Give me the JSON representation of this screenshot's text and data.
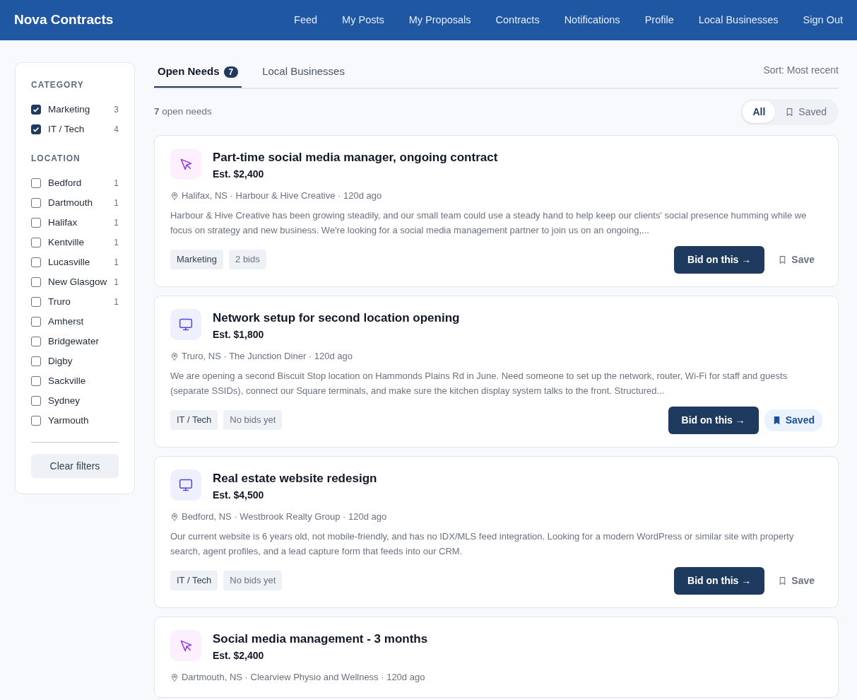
{
  "brand": "Nova Contracts",
  "nav": [
    "Feed",
    "My Posts",
    "My Proposals",
    "Contracts",
    "Notifications",
    "Profile",
    "Local Businesses",
    "Sign Out"
  ],
  "filters": [
    {
      "heading": "CATEGORY",
      "options": [
        {
          "label": "Marketing",
          "count": "3",
          "checked": true
        },
        {
          "label": "IT / Tech",
          "count": "4",
          "checked": true
        }
      ]
    },
    {
      "heading": "LOCATION",
      "options": [
        {
          "label": "Bedford",
          "count": "1",
          "checked": false
        },
        {
          "label": "Dartmouth",
          "count": "1",
          "checked": false
        },
        {
          "label": "Halifax",
          "count": "1",
          "checked": false
        },
        {
          "label": "Kentville",
          "count": "1",
          "checked": false
        },
        {
          "label": "Lucasville",
          "count": "1",
          "checked": false
        },
        {
          "label": "New Glasgow",
          "count": "1",
          "checked": false
        },
        {
          "label": "Truro",
          "count": "1",
          "checked": false
        },
        {
          "label": "Amherst",
          "checked": false
        },
        {
          "label": "Bridgewater",
          "checked": false
        },
        {
          "label": "Digby",
          "checked": false
        },
        {
          "label": "Sackville",
          "checked": false
        },
        {
          "label": "Sydney",
          "checked": false
        },
        {
          "label": "Yarmouth",
          "checked": false
        }
      ]
    }
  ],
  "clear_button": "Clear filters",
  "tabs": [
    {
      "label": "Open Needs",
      "badge": "7",
      "selected": true
    },
    {
      "label": "Local Businesses",
      "selected": false
    }
  ],
  "sort": "Sort: Most recent",
  "count_text": "**7** open needs",
  "view_toggle": [
    {
      "label": "All",
      "selected": true
    },
    {
      "label": "Saved",
      "selected": false
    }
  ],
  "needs": [
    {
      "kind": "cursor",
      "title": "Part-time social media manager, ongoing contract",
      "estimate": "Est. $2,400",
      "meta": "Halifax, NS · Harbour & Hive Creative · 120d ago",
      "description": "Harbour & Hive Creative has been growing steadily, and our small team could use a steady hand to help keep our clients' social presence humming while we focus on strategy and new business. We're looking for a social media management partner to join us on an ongoing,...",
      "tags": [
        "Marketing",
        "2 bids"
      ],
      "bid_button": "Bid on this →",
      "save_label": "Save",
      "saved": false
    },
    {
      "kind": "monitor",
      "title": "Network setup for second location opening",
      "estimate": "Est. $1,800",
      "meta": "Truro, NS · The Junction Diner · 120d ago",
      "description": "We are opening a second Biscuit Stop location on Hammonds Plains Rd in June. Need someone to set up the network, router, Wi-Fi for staff and guests (separate SSIDs), connect our Square terminals, and make sure the kitchen display system talks to the front. Structured...",
      "tags": [
        "IT / Tech",
        "No bids yet"
      ],
      "bid_button": "Bid on this →",
      "save_label": "Saved",
      "saved": true
    },
    {
      "kind": "monitor",
      "title": "Real estate website redesign",
      "estimate": "Est. $4,500",
      "meta": "Bedford, NS · Westbrook Realty Group · 120d ago",
      "description": "Our current website is 6 years old, not mobile-friendly, and has no IDX/MLS feed integration. Looking for a modern WordPress or similar site with property search, agent profiles, and a lead capture form that feeds into our CRM.",
      "tags": [
        "IT / Tech",
        "No bids yet"
      ],
      "bid_button": "Bid on this →",
      "save_label": "Save",
      "saved": false
    },
    {
      "kind": "cursor",
      "title": "Social media management - 3 months",
      "estimate": "Est. $2,400",
      "meta": "Dartmouth, NS · Clearview Physio and Wellness · 120d ago"
    }
  ]
}
